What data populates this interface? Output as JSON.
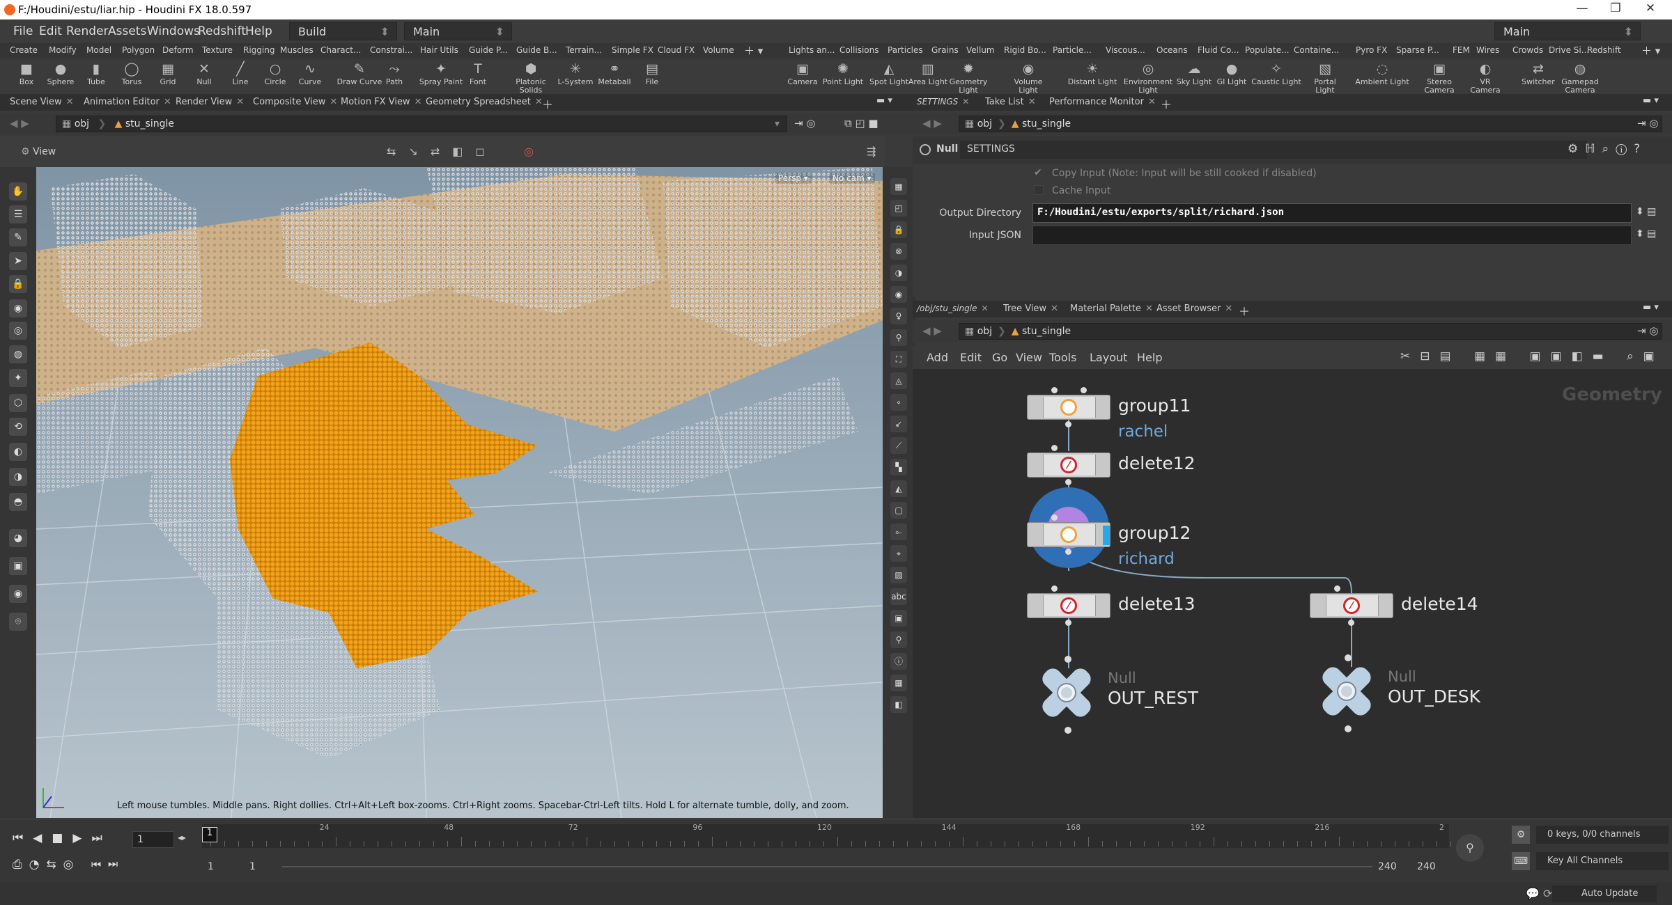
{
  "window": {
    "title": "F:/Houdini/estu/liar.hip - Houdini FX 18.0.597"
  },
  "menu": [
    "File",
    "Edit",
    "Render",
    "Assets",
    "Windows",
    "Redshift",
    "Help"
  ],
  "desktop_build": "Build",
  "desktop_main": "Main",
  "desktop_right": "Main",
  "shelf_tabs_left": [
    "Create",
    "Modify",
    "Model",
    "Polygon",
    "Deform",
    "Texture",
    "Rigging",
    "Muscles",
    "Charact...",
    "Constrai...",
    "Hair Utils",
    "Guide P...",
    "Guide B...",
    "Terrain...",
    "Simple FX",
    "Cloud FX",
    "Volume"
  ],
  "shelf_tabs_right": [
    "Lights an...",
    "Collisions",
    "Particles",
    "Grains",
    "Vellum",
    "Rigid Bo...",
    "Particle...",
    "Viscous...",
    "Oceans",
    "Fluid Co...",
    "Populate...",
    "Containe...",
    "Pyro FX",
    "Sparse P...",
    "FEM",
    "Wires",
    "Crowds",
    "Drive Si...",
    "Redshift"
  ],
  "tools_left": [
    {
      "label": "Box",
      "icon": "■"
    },
    {
      "label": "Sphere",
      "icon": "●"
    },
    {
      "label": "Tube",
      "icon": "▮"
    },
    {
      "label": "Torus",
      "icon": "◯"
    },
    {
      "label": "Grid",
      "icon": "▦"
    },
    {
      "label": "Null",
      "icon": "✕"
    },
    {
      "label": "Line",
      "icon": "╱"
    },
    {
      "label": "Circle",
      "icon": "○"
    },
    {
      "label": "Curve",
      "icon": "∿"
    },
    {
      "label": "Draw Curve",
      "icon": "✎"
    },
    {
      "label": "Path",
      "icon": "⤳"
    },
    {
      "label": "Spray Paint",
      "icon": "✦"
    },
    {
      "label": "Font",
      "icon": "T"
    },
    {
      "label": "Platonic Solids",
      "icon": "⬢"
    },
    {
      "label": "L-System",
      "icon": "✳"
    },
    {
      "label": "Metaball",
      "icon": "⚭"
    },
    {
      "label": "File",
      "icon": "▤"
    }
  ],
  "tools_right": [
    {
      "label": "Camera",
      "icon": "▣"
    },
    {
      "label": "Point Light",
      "icon": "✺"
    },
    {
      "label": "Spot Light",
      "icon": "◭"
    },
    {
      "label": "Area Light",
      "icon": "▥"
    },
    {
      "label": "Geometry Light",
      "icon": "✹"
    },
    {
      "label": "Volume Light",
      "icon": "◉"
    },
    {
      "label": "Distant Light",
      "icon": "☀"
    },
    {
      "label": "Environment Light",
      "icon": "◎"
    },
    {
      "label": "Sky Light",
      "icon": "☁"
    },
    {
      "label": "GI Light",
      "icon": "●"
    },
    {
      "label": "Caustic Light",
      "icon": "✧"
    },
    {
      "label": "Portal Light",
      "icon": "▧"
    },
    {
      "label": "Ambient Light",
      "icon": "◌"
    },
    {
      "label": "Stereo Camera",
      "icon": "▣"
    },
    {
      "label": "VR Camera",
      "icon": "◐"
    },
    {
      "label": "Switcher",
      "icon": "⇄"
    },
    {
      "label": "Gamepad Camera",
      "icon": "◍"
    }
  ],
  "left_tabs": [
    "Scene View",
    "Animation Editor",
    "Render View",
    "Composite View",
    "Motion FX View",
    "Geometry Spreadsheet"
  ],
  "path": {
    "obj": "obj",
    "node": "stu_single"
  },
  "viewport": {
    "label": "View",
    "persp": "Persp ▾",
    "cam": "No cam ▾",
    "hint": "Left mouse tumbles. Middle pans. Right dollies. Ctrl+Alt+Left box-zooms. Ctrl+Right zooms. Spacebar-Ctrl-Left tilts. Hold L for alternate tumble, dolly, and zoom."
  },
  "params": {
    "tabs": [
      "SETTINGS",
      "Take List",
      "Performance Monitor"
    ],
    "type": "Null",
    "name": "SETTINGS",
    "copy_input": "Copy Input (Note: Input will be still cooked if disabled)",
    "cache_input": "Cache Input",
    "output_dir_label": "Output Directory",
    "output_dir_value": "F:/Houdini/estu/exports/split/richard.json",
    "input_json_label": "Input JSON",
    "input_json_value": ""
  },
  "network": {
    "tabs": [
      "/obj/stu_single",
      "Tree View",
      "Material Palette",
      "Asset Browser"
    ],
    "menu": [
      "Add",
      "Edit",
      "Go",
      "View",
      "Tools",
      "Layout",
      "Help"
    ],
    "context": "Geometry",
    "nodes": [
      {
        "name": "group11",
        "sub": "rachel"
      },
      {
        "name": "delete12"
      },
      {
        "name": "group12",
        "sub": "richard"
      },
      {
        "name": "delete13"
      },
      {
        "name": "delete14"
      },
      {
        "name": "OUT_REST",
        "type": "Null"
      },
      {
        "name": "OUT_DESK",
        "type": "Null"
      }
    ]
  },
  "timeline": {
    "frame": "1",
    "ticks": [
      "1",
      "24",
      "48",
      "72",
      "96",
      "120",
      "144",
      "168",
      "192",
      "216",
      "2"
    ],
    "start": "1",
    "start2": "1",
    "end": "240",
    "end2": "240",
    "keys": "0 keys, 0/0 channels",
    "key_all": "Key All Channels",
    "auto_update": "Auto Update"
  },
  "colors": {
    "accent": "#f5a015",
    "selected_points": "#e89a12",
    "node_blue": "#2f6fb5",
    "subtext": "#6fa9e0"
  }
}
